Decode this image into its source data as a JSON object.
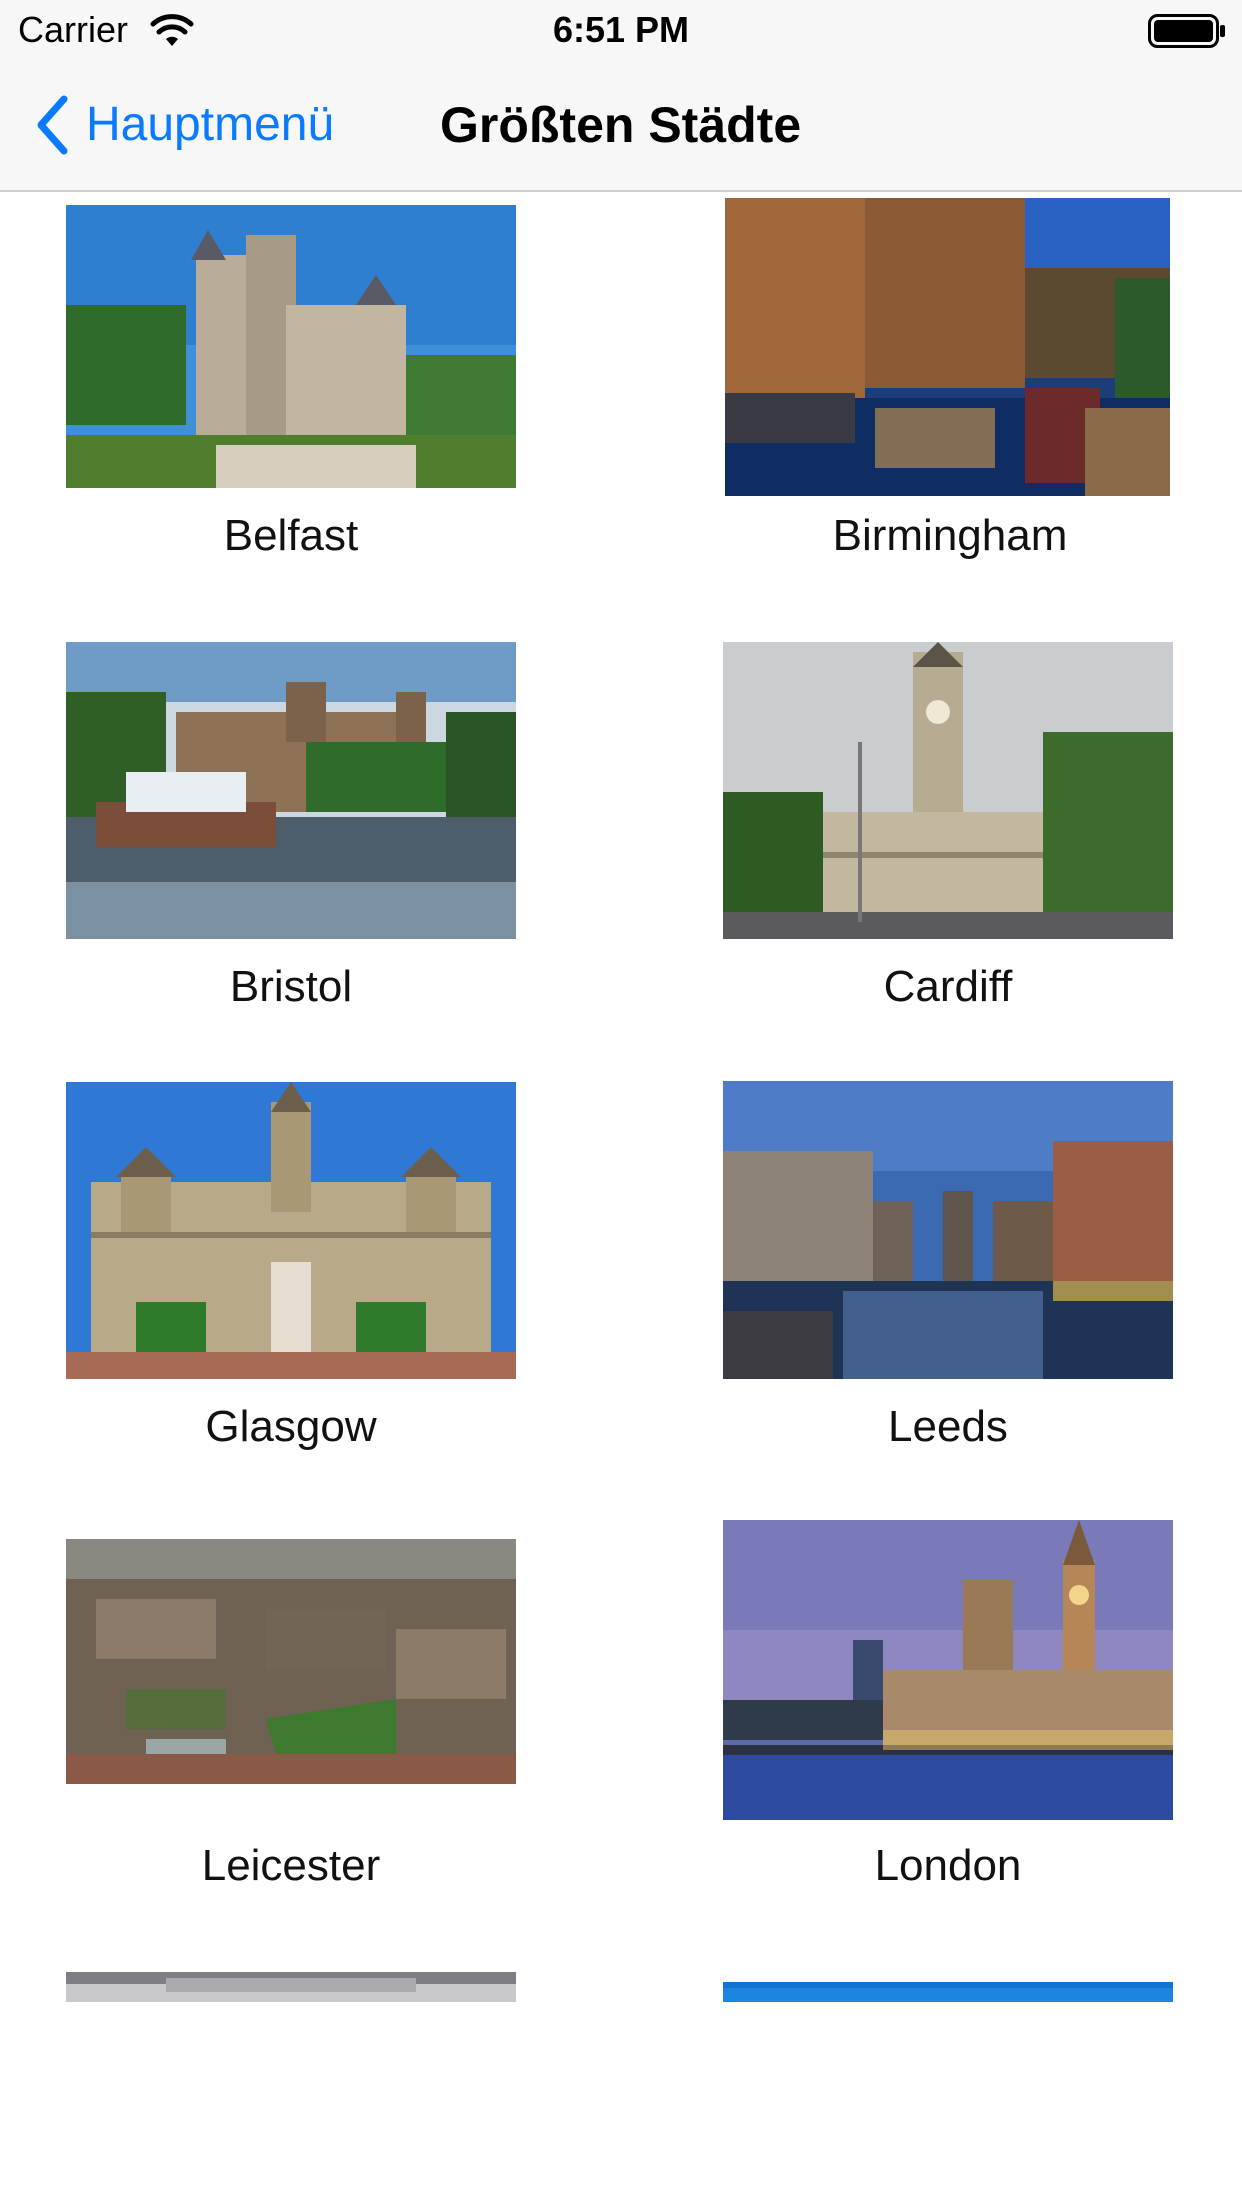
{
  "status_bar": {
    "carrier": "Carrier",
    "time": "6:51 PM",
    "icons": [
      "wifi-icon",
      "battery-icon"
    ]
  },
  "nav": {
    "back_label": "Hauptmenü",
    "back_icon": "chevron-left-icon",
    "title": "Größten Städte",
    "accent_color": "#0a7aff"
  },
  "cities": [
    {
      "name": "Belfast",
      "image": "castle-photo"
    },
    {
      "name": "Birmingham",
      "image": "canal-night-photo"
    },
    {
      "name": "Bristol",
      "image": "cathedral-fountain-photo"
    },
    {
      "name": "Cardiff",
      "image": "city-hall-clocktower-photo"
    },
    {
      "name": "Glasgow",
      "image": "city-chambers-photo"
    },
    {
      "name": "Leeds",
      "image": "dock-dusk-photo"
    },
    {
      "name": "Leicester",
      "image": "aerial-city-photo"
    },
    {
      "name": "London",
      "image": "westminster-dusk-photo"
    },
    {
      "name": "",
      "image": "cloudy-sky-photo"
    },
    {
      "name": "",
      "image": "blue-sky-photo"
    }
  ]
}
